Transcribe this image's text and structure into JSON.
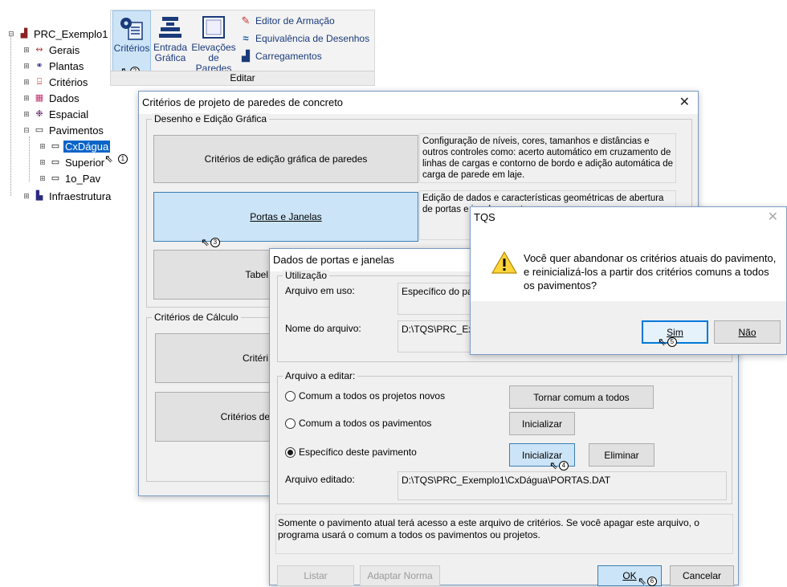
{
  "tree": {
    "root": "PRC_Exemplo1",
    "items": [
      "Gerais",
      "Plantas",
      "Critérios",
      "Dados",
      "Espacial",
      "Pavimentos"
    ],
    "pavimentos": [
      "CxDágua",
      "Superior",
      "1o_Pav"
    ],
    "last": "Infraestrutura"
  },
  "ribbon": {
    "criterios": "Critérios",
    "entrada_line1": "Entrada",
    "entrada_line2": "Gráfica",
    "elevacoes_line1": "Elevações",
    "elevacoes_line2": "de Paredes",
    "editor_armacao": "Editor de Armação",
    "equivalencia": "Equivalência de Desenhos",
    "carregamentos": "Carregamentos",
    "group_label": "Editar"
  },
  "callouts": [
    "1",
    "2",
    "3",
    "4",
    "5",
    "6"
  ],
  "criteria_dialog": {
    "title": "Critérios de projeto de paredes de concreto",
    "group1": "Desenho e Edição Gráfica",
    "btn_edicao": "Critérios de edição gráfica de paredes",
    "desc_edicao": "Configuração de níveis, cores, tamanhos e distâncias e outros controles como: acerto automático em cruzamento de linhas de cargas e contorno de bordo e adição automática de carga de parede em laje.",
    "btn_portas": "Portas e Janelas",
    "desc_portas": "Edição de dados e características geométricas de abertura de portas e janelas, contra-verga",
    "btn_tabela": "Tabel",
    "group2": "Critérios de Cálculo",
    "btn_calc1": "Critéri",
    "btn_calc2": "Critérios de"
  },
  "portas_dialog": {
    "title": "Dados de portas e janelas",
    "group_utilizacao": "Utilização",
    "label_arquivo_uso": "Arquivo em uso:",
    "value_arquivo_uso": "Específico do pa",
    "label_nome": "Nome do arquivo:",
    "value_nome": "D:\\TQS\\PRC_Ex",
    "group_editar": "Arquivo a editar:",
    "radio_projetos": "Comum a todos os projetos novos",
    "radio_pavimentos": "Comum a todos os pavimentos",
    "radio_especifico": "Específico deste pavimento",
    "btn_tornar": "Tornar comum a todos",
    "btn_inicializar1": "Inicializar",
    "btn_inicializar2": "Inicializar",
    "btn_eliminar": "Eliminar",
    "label_editado": "Arquivo editado:",
    "value_editado": "D:\\TQS\\PRC_Exemplo1\\CxDágua\\PORTAS.DAT",
    "info": "Somente o pavimento atual terá acesso a este arquivo de critérios. Se você apagar este arquivo, o programa usará o comum a todos os pavimentos ou projetos.",
    "btn_listar": "Listar",
    "btn_adaptar": "Adaptar Norma",
    "btn_ok": "OK",
    "btn_cancelar": "Cancelar"
  },
  "tqs_dialog": {
    "title": "TQS",
    "message": "Você quer abandonar os critérios atuais do pavimento, e reinicializá-los a partir dos critérios comuns a todos os pavimentos?",
    "btn_sim": "Sim",
    "btn_nao": "Não"
  },
  "colors": {
    "selection": "#0a64c8",
    "hot_button": "#cce4f7",
    "ribbon_active": "#cde4f7"
  }
}
